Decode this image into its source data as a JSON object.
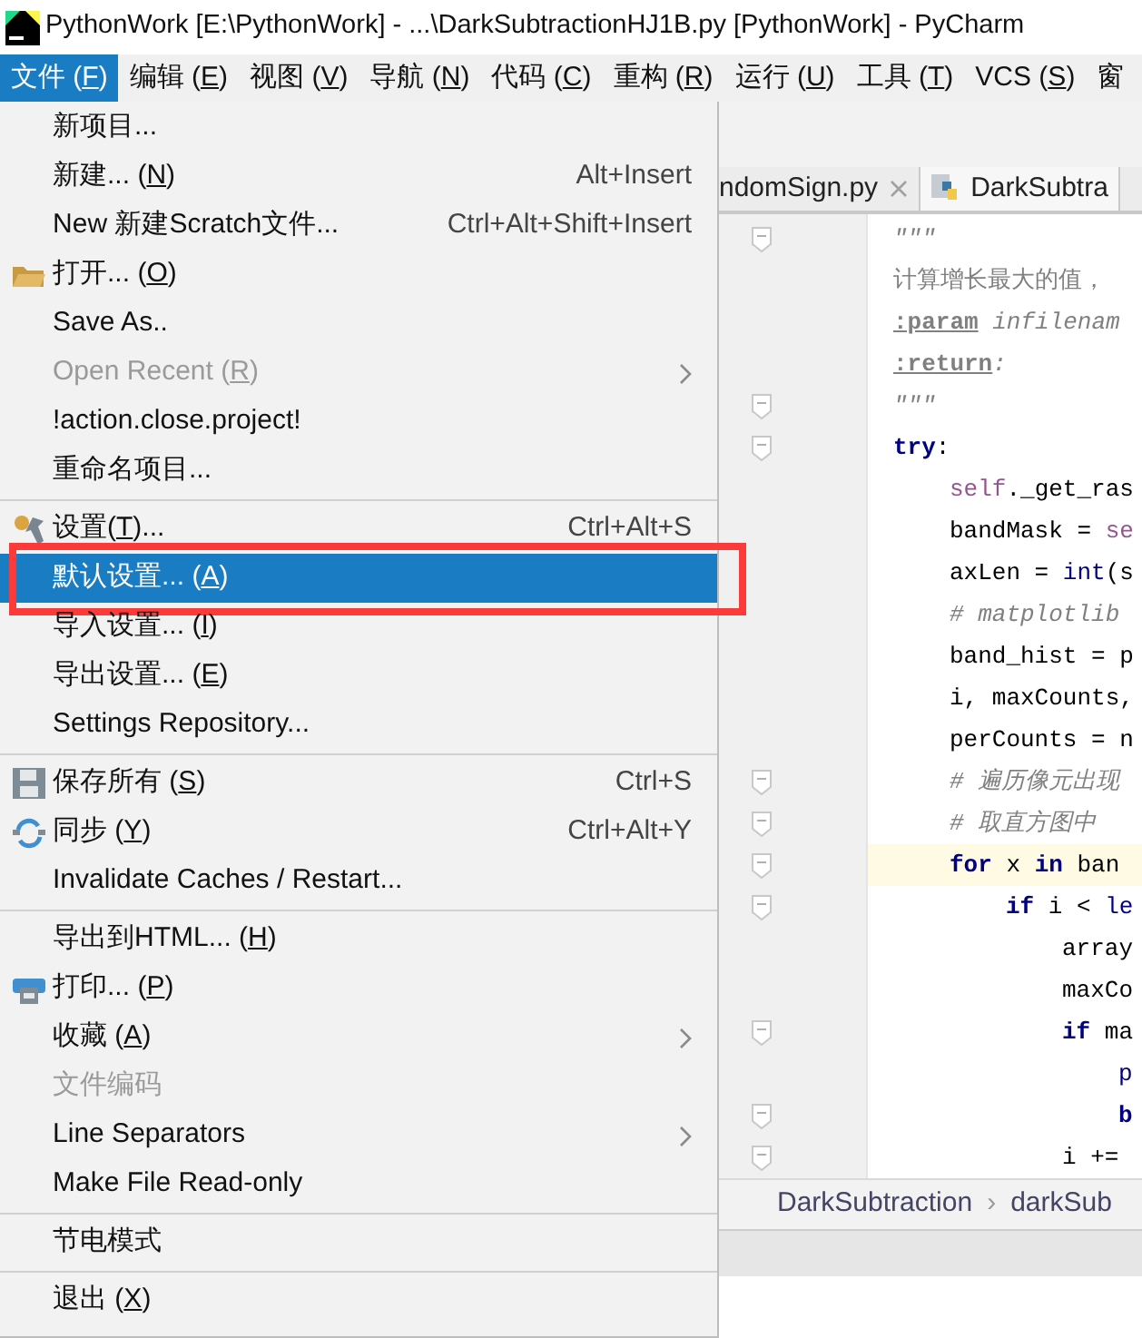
{
  "window": {
    "title": "PythonWork [E:\\PythonWork] - ...\\DarkSubtractionHJ1B.py [PythonWork] - PyCharm"
  },
  "menu_bar": [
    {
      "label": "文件 (F)",
      "selected": true
    },
    {
      "label": "编辑 (E)",
      "selected": false
    },
    {
      "label": "视图 (V)",
      "selected": false
    },
    {
      "label": "导航 (N)",
      "selected": false
    },
    {
      "label": "代码 (C)",
      "selected": false
    },
    {
      "label": "重构 (R)",
      "selected": false
    },
    {
      "label": "运行 (U)",
      "selected": false
    },
    {
      "label": "工具 (T)",
      "selected": false
    },
    {
      "label": "VCS (S)",
      "selected": false
    },
    {
      "label": "窗",
      "selected": false
    }
  ],
  "editor_tabs": [
    {
      "label": "ndomSign.py",
      "selected": false,
      "closable": true
    },
    {
      "label": "DarkSubtra",
      "selected": true,
      "closable": false
    }
  ],
  "code_lines": [
    {
      "fold": true,
      "current": false,
      "tokens": [
        {
          "text": "\"\"\"",
          "kind": "doc"
        }
      ]
    },
    {
      "fold": false,
      "current": false,
      "tokens": [
        {
          "text": "计算增长最大的值，",
          "kind": "docplain"
        }
      ]
    },
    {
      "fold": false,
      "current": false,
      "tokens": [
        {
          "text": ":param",
          "kind": "doctag"
        },
        {
          "text": " infilenam",
          "kind": "docparam"
        }
      ]
    },
    {
      "fold": false,
      "current": false,
      "tokens": [
        {
          "text": ":return",
          "kind": "doctag"
        },
        {
          "text": ":",
          "kind": "doc"
        }
      ]
    },
    {
      "fold": true,
      "current": false,
      "tokens": [
        {
          "text": "\"\"\"",
          "kind": "doc"
        }
      ]
    },
    {
      "fold": true,
      "current": false,
      "tokens": [
        {
          "text": "try",
          "kind": "keyword"
        },
        {
          "text": ":",
          "kind": "plain"
        }
      ],
      "children": [
        {
          "fold": false,
          "current": false,
          "tokens": [
            {
              "text": "self",
              "kind": "self"
            },
            {
              "text": "._get_ras",
              "kind": "plain"
            }
          ]
        },
        {
          "fold": false,
          "current": false,
          "tokens": [
            {
              "text": "bandMask = ",
              "kind": "plain"
            },
            {
              "text": "se",
              "kind": "self"
            }
          ]
        },
        {
          "fold": false,
          "current": false,
          "tokens": [
            {
              "text": "axLen = ",
              "kind": "plain"
            },
            {
              "text": "int",
              "kind": "builtin"
            },
            {
              "text": "(s",
              "kind": "plain"
            }
          ]
        },
        {
          "fold": false,
          "current": false,
          "tokens": [
            {
              "text": "# matplotlib",
              "kind": "comment"
            }
          ]
        },
        {
          "fold": false,
          "current": false,
          "tokens": [
            {
              "text": "band_hist = p",
              "kind": "plain"
            }
          ]
        },
        {
          "fold": false,
          "current": false,
          "tokens": [
            {
              "text": "i, maxCounts,",
              "kind": "plain"
            }
          ]
        },
        {
          "fold": false,
          "current": false,
          "tokens": [
            {
              "text": "perCounts = n",
              "kind": "plain"
            }
          ]
        },
        {
          "fold": true,
          "current": false,
          "tokens": [
            {
              "text": "# 遍历像元出现",
              "kind": "comment"
            }
          ]
        },
        {
          "fold": true,
          "current": false,
          "tokens": [
            {
              "text": "# 取直方图中",
              "kind": "comment"
            }
          ]
        },
        {
          "fold": true,
          "current": true,
          "tokens": [
            {
              "text": "for",
              "kind": "keyword"
            },
            {
              "text": " x ",
              "kind": "plain"
            },
            {
              "text": "in",
              "kind": "keyword"
            },
            {
              "text": " ban",
              "kind": "plain"
            }
          ],
          "children": [
            {
              "fold": true,
              "current": false,
              "tokens": [
                {
                  "text": "if",
                  "kind": "keyword"
                },
                {
                  "text": " i < ",
                  "kind": "plain"
                },
                {
                  "text": "le",
                  "kind": "builtin"
                }
              ],
              "children": [
                {
                  "fold": false,
                  "current": false,
                  "tokens": [
                    {
                      "text": "array",
                      "kind": "plain"
                    }
                  ]
                },
                {
                  "fold": false,
                  "current": false,
                  "tokens": [
                    {
                      "text": "maxCo",
                      "kind": "plain"
                    }
                  ]
                },
                {
                  "fold": true,
                  "current": false,
                  "tokens": [
                    {
                      "text": "if",
                      "kind": "keyword"
                    },
                    {
                      "text": " ma",
                      "kind": "plain"
                    }
                  ],
                  "children": [
                    {
                      "fold": false,
                      "current": false,
                      "tokens": [
                        {
                          "text": "p",
                          "kind": "builtin"
                        }
                      ]
                    },
                    {
                      "fold": true,
                      "current": false,
                      "tokens": [
                        {
                          "text": "b",
                          "kind": "keyword"
                        }
                      ]
                    }
                  ]
                },
                {
                  "fold": true,
                  "current": false,
                  "tokens": [
                    {
                      "text": "i +=",
                      "kind": "plain"
                    }
                  ]
                }
              ]
            }
          ]
        }
      ]
    }
  ],
  "breadcrumb": [
    {
      "label": "DarkSubtraction"
    },
    {
      "label": "darkSub"
    }
  ],
  "breadcrumb_separator": "›",
  "file_menu": [
    {
      "kind": "item",
      "label": "新项目...",
      "disabled": false,
      "selected": false,
      "submenu": false
    },
    {
      "kind": "item",
      "label": "新建... (N)",
      "shortcut": "Alt+Insert",
      "disabled": false,
      "selected": false,
      "submenu": false
    },
    {
      "kind": "item",
      "label": "New 新建Scratch文件...",
      "shortcut": "Ctrl+Alt+Shift+Insert",
      "disabled": false,
      "selected": false,
      "submenu": false
    },
    {
      "kind": "folder_item",
      "label": "打开... (O)",
      "disabled": false,
      "selected": false,
      "submenu": false
    },
    {
      "kind": "item",
      "label": "Save As..",
      "disabled": false,
      "selected": false,
      "submenu": false
    },
    {
      "kind": "item",
      "label": "Open Recent (R)",
      "disabled": true,
      "selected": false,
      "submenu": true
    },
    {
      "kind": "item",
      "label": "!action.close.project!",
      "disabled": false,
      "selected": false,
      "submenu": false
    },
    {
      "kind": "item",
      "label": "重命名项目...",
      "disabled": false,
      "selected": false,
      "submenu": false
    },
    {
      "kind": "separator"
    },
    {
      "kind": "settings_item",
      "label": "设置(T)...",
      "shortcut": "Ctrl+Alt+S",
      "disabled": false,
      "selected": false,
      "submenu": false
    },
    {
      "kind": "item",
      "label": "默认设置... (A)",
      "disabled": false,
      "selected": true,
      "submenu": false,
      "highlighted_box": true
    },
    {
      "kind": "item",
      "label": "导入设置... (I)",
      "disabled": false,
      "selected": false,
      "submenu": false
    },
    {
      "kind": "item",
      "label": "导出设置... (E)",
      "disabled": false,
      "selected": false,
      "submenu": false
    },
    {
      "kind": "item",
      "label": "Settings Repository...",
      "disabled": false,
      "selected": false,
      "submenu": false
    },
    {
      "kind": "separator"
    },
    {
      "kind": "save_item",
      "label": "保存所有 (S)",
      "shortcut": "Ctrl+S",
      "disabled": false,
      "selected": false,
      "submenu": false
    },
    {
      "kind": "sync_item",
      "label": "同步 (Y)",
      "shortcut": "Ctrl+Alt+Y",
      "disabled": false,
      "selected": false,
      "submenu": false
    },
    {
      "kind": "item",
      "label": "Invalidate Caches / Restart...",
      "disabled": false,
      "selected": false,
      "submenu": false
    },
    {
      "kind": "separator"
    },
    {
      "kind": "item",
      "label": "导出到HTML... (H)",
      "disabled": false,
      "selected": false,
      "submenu": false
    },
    {
      "kind": "print_item",
      "label": "打印... (P)",
      "disabled": false,
      "selected": false,
      "submenu": false
    },
    {
      "kind": "item",
      "label": "收藏 (A)",
      "disabled": false,
      "selected": false,
      "submenu": true
    },
    {
      "kind": "item",
      "label": "文件编码",
      "disabled": true,
      "selected": false,
      "submenu": false
    },
    {
      "kind": "item",
      "label": "Line Separators",
      "disabled": false,
      "selected": false,
      "submenu": true
    },
    {
      "kind": "item",
      "label": "Make File Read-only",
      "disabled": false,
      "selected": false,
      "submenu": false
    },
    {
      "kind": "separator"
    },
    {
      "kind": "item",
      "label": "节电模式",
      "disabled": false,
      "selected": false,
      "submenu": false
    },
    {
      "kind": "separator"
    },
    {
      "kind": "item",
      "label": "退出 (X)",
      "disabled": false,
      "selected": false,
      "submenu": false
    }
  ]
}
